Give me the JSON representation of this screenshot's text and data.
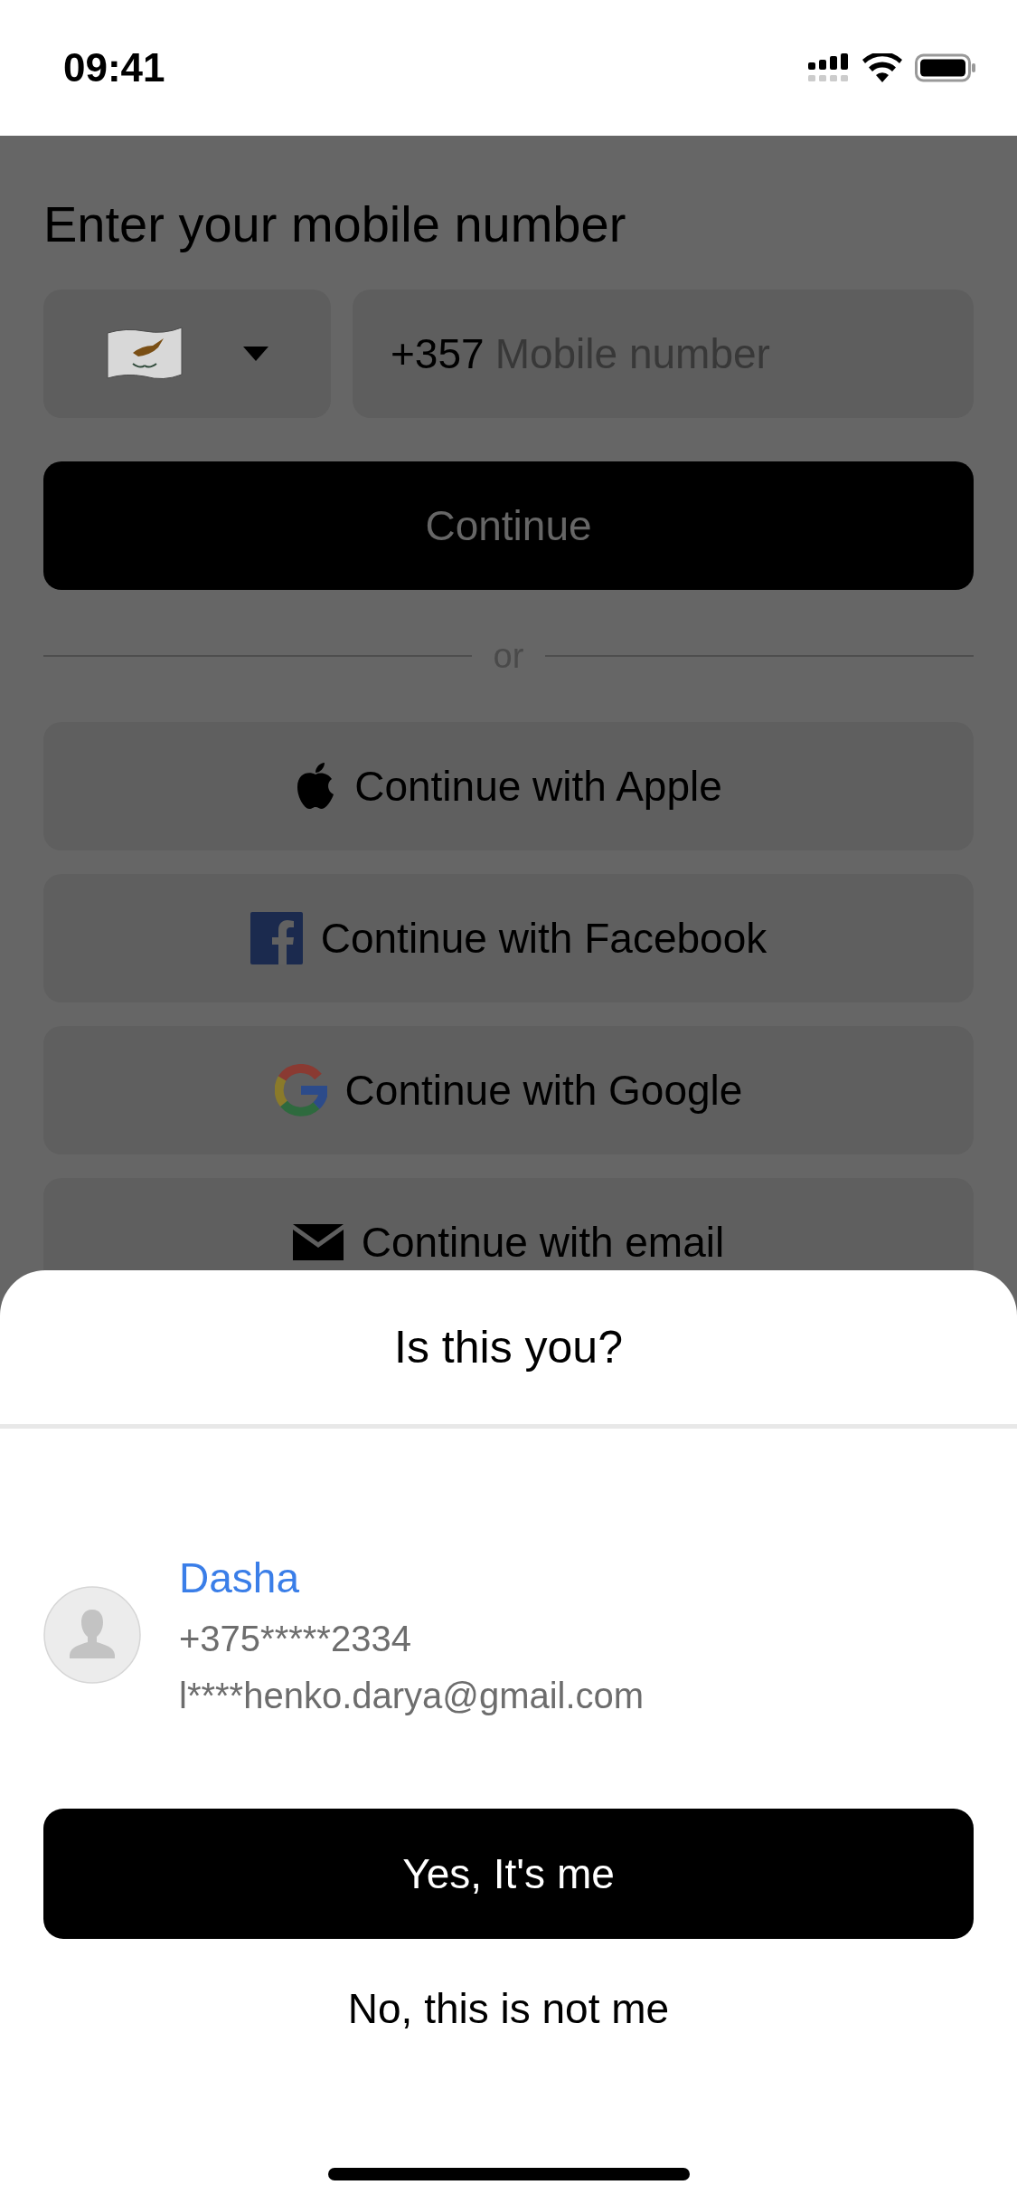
{
  "status_bar": {
    "time": "09:41"
  },
  "background": {
    "title": "Enter your mobile number",
    "phone_field": {
      "prefix": "+357",
      "placeholder": "Mobile number"
    },
    "continue_button": "Continue",
    "divider": "or",
    "social_buttons": [
      {
        "kind": "apple",
        "label": "Continue with Apple"
      },
      {
        "kind": "facebook",
        "label": "Continue with Facebook"
      },
      {
        "kind": "google",
        "label": "Continue with Google"
      },
      {
        "kind": "email",
        "label": "Continue with email"
      }
    ]
  },
  "sheet": {
    "title": "Is this you?",
    "account": {
      "name": "Dasha",
      "phone": "+375*****2334",
      "email": "l****henko.darya@gmail.com"
    },
    "confirm_button": "Yes, It's me",
    "decline_button": "No, this is not me"
  }
}
